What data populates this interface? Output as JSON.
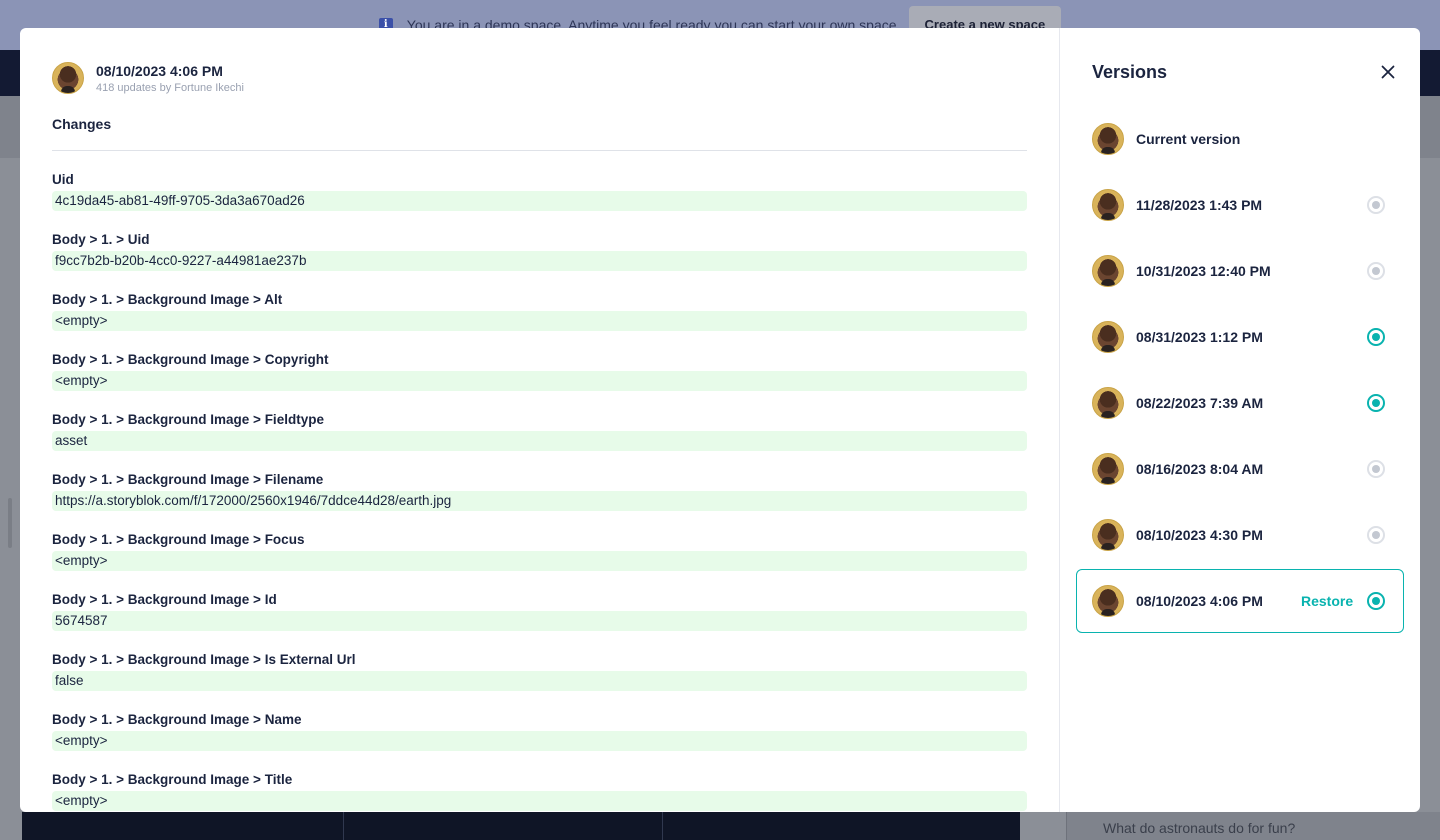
{
  "background": {
    "banner_text": "You are in a demo space. Anytime you feel ready you can start your own space",
    "banner_button": "Create a new space",
    "right_card_text": "What do astronauts do for fun?"
  },
  "changes": {
    "header": {
      "date": "08/10/2023 4:06 PM",
      "subtitle": "418 updates by Fortune Ikechi"
    },
    "title": "Changes",
    "fields": [
      {
        "label": "Uid",
        "value": "4c19da45-ab81-49ff-9705-3da3a670ad26"
      },
      {
        "label": "Body > 1. > Uid",
        "value": "f9cc7b2b-b20b-4cc0-9227-a44981ae237b"
      },
      {
        "label": "Body > 1. > Background Image > Alt",
        "value": "<empty>"
      },
      {
        "label": "Body > 1. > Background Image > Copyright",
        "value": "<empty>"
      },
      {
        "label": "Body > 1. > Background Image > Fieldtype",
        "value": "asset"
      },
      {
        "label": "Body > 1. > Background Image > Filename",
        "value": "https://a.storyblok.com/f/172000/2560x1946/7ddce44d28/earth.jpg"
      },
      {
        "label": "Body > 1. > Background Image > Focus",
        "value": "<empty>"
      },
      {
        "label": "Body > 1. > Background Image > Id",
        "value": "5674587"
      },
      {
        "label": "Body > 1. > Background Image > Is External Url",
        "value": "false"
      },
      {
        "label": "Body > 1. > Background Image > Name",
        "value": "<empty>"
      },
      {
        "label": "Body > 1. > Background Image > Title",
        "value": "<empty>"
      }
    ]
  },
  "versions": {
    "title": "Versions",
    "close_icon": "close-icon",
    "restore_label": "Restore",
    "accent_color": "#09b3af",
    "items": [
      {
        "label": "Current version",
        "radio": "none"
      },
      {
        "label": "11/28/2023 1:43 PM",
        "radio": "off"
      },
      {
        "label": "10/31/2023 12:40 PM",
        "radio": "off"
      },
      {
        "label": "08/31/2023 1:12 PM",
        "radio": "on"
      },
      {
        "label": "08/22/2023 7:39 AM",
        "radio": "on"
      },
      {
        "label": "08/16/2023 8:04 AM",
        "radio": "off"
      },
      {
        "label": "08/10/2023 4:30 PM",
        "radio": "off"
      },
      {
        "label": "08/10/2023 4:06 PM",
        "radio": "on",
        "selected": true
      }
    ]
  }
}
